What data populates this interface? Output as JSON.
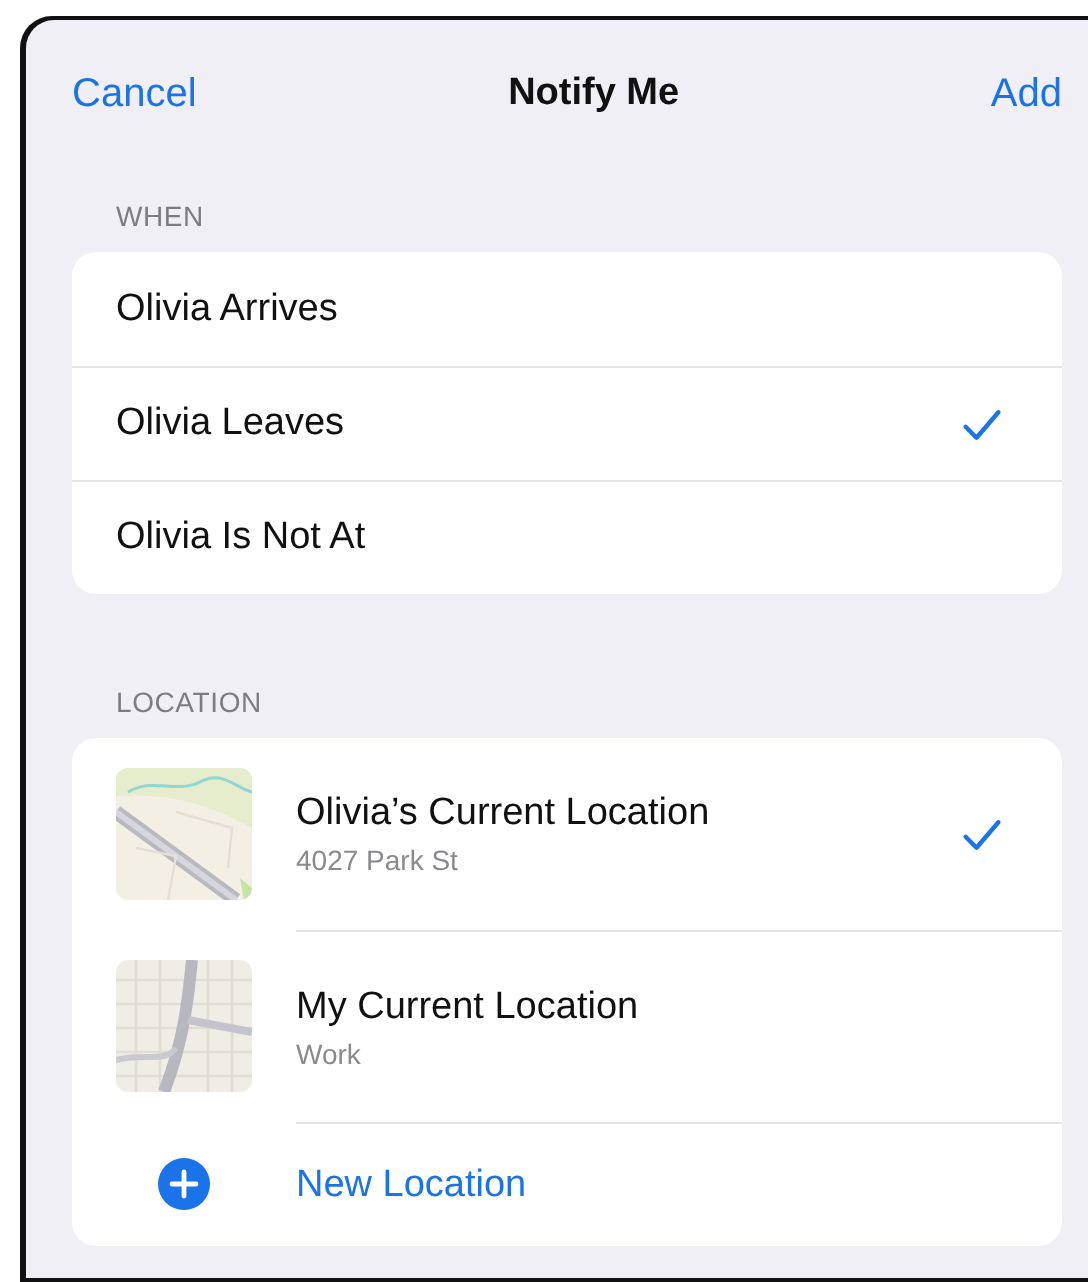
{
  "nav": {
    "cancel": "Cancel",
    "title": "Notify Me",
    "add": "Add"
  },
  "when": {
    "header": "WHEN",
    "options": [
      {
        "label": "Olivia Arrives",
        "selected": false
      },
      {
        "label": "Olivia Leaves",
        "selected": true
      },
      {
        "label": "Olivia Is Not At",
        "selected": false
      }
    ]
  },
  "location": {
    "header": "LOCATION",
    "items": [
      {
        "title": "Olivia’s Current Location",
        "subtitle": "4027 Park St",
        "selected": true
      },
      {
        "title": "My Current Location",
        "subtitle": "Work",
        "selected": false
      }
    ],
    "new_location": "New Location"
  }
}
